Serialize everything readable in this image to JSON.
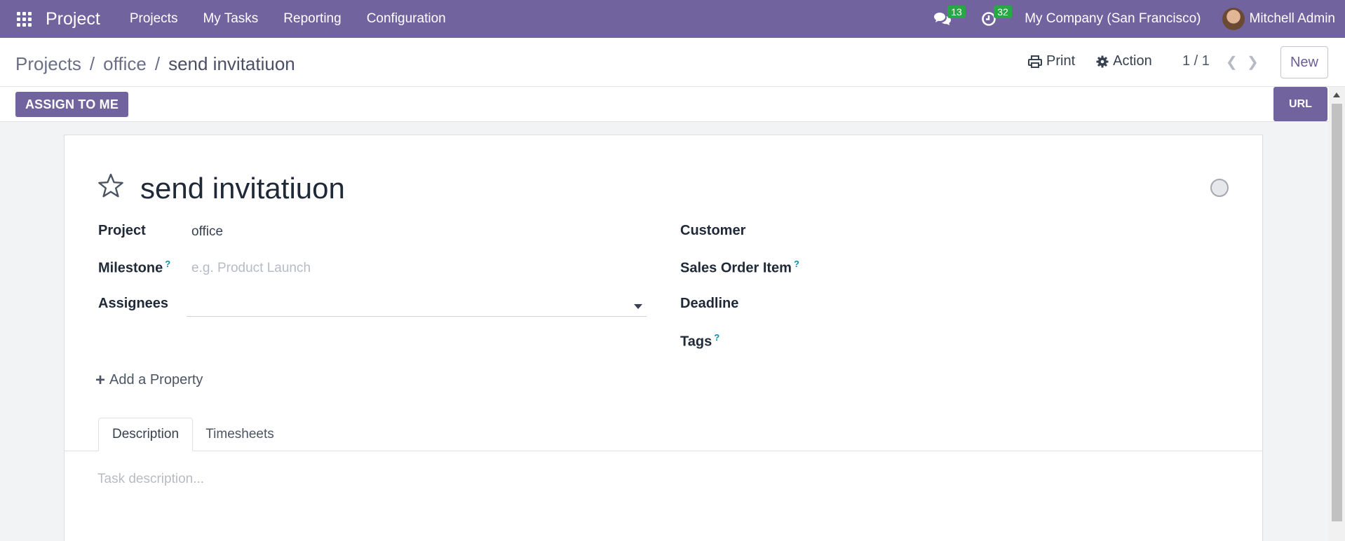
{
  "navbar": {
    "app_name": "Project",
    "menu": [
      "Projects",
      "My Tasks",
      "Reporting",
      "Configuration"
    ],
    "messages_count": "13",
    "activities_count": "32",
    "company": "My Company (San Francisco)",
    "user": "Mitchell Admin",
    "accent_color": "#71639e"
  },
  "breadcrumb": {
    "items": [
      "Projects",
      "office"
    ],
    "current": "send invitatiuon"
  },
  "toolbar": {
    "print_label": "Print",
    "action_label": "Action",
    "pager": "1 / 1",
    "new_label": "New"
  },
  "statusbar": {
    "assign_label": "ASSIGN TO ME",
    "url_label": "URL"
  },
  "form": {
    "title": "send invitatiuon",
    "left_fields": {
      "project_label": "Project",
      "project_value": "office",
      "milestone_label": "Milestone",
      "milestone_placeholder": "e.g. Product Launch",
      "assignees_label": "Assignees"
    },
    "right_fields": {
      "customer_label": "Customer",
      "sales_order_label": "Sales Order Item",
      "deadline_label": "Deadline",
      "tags_label": "Tags"
    },
    "help_mark": "?",
    "add_property_label": "Add a Property",
    "tabs": [
      "Description",
      "Timesheets"
    ],
    "description_placeholder": "Task description..."
  }
}
